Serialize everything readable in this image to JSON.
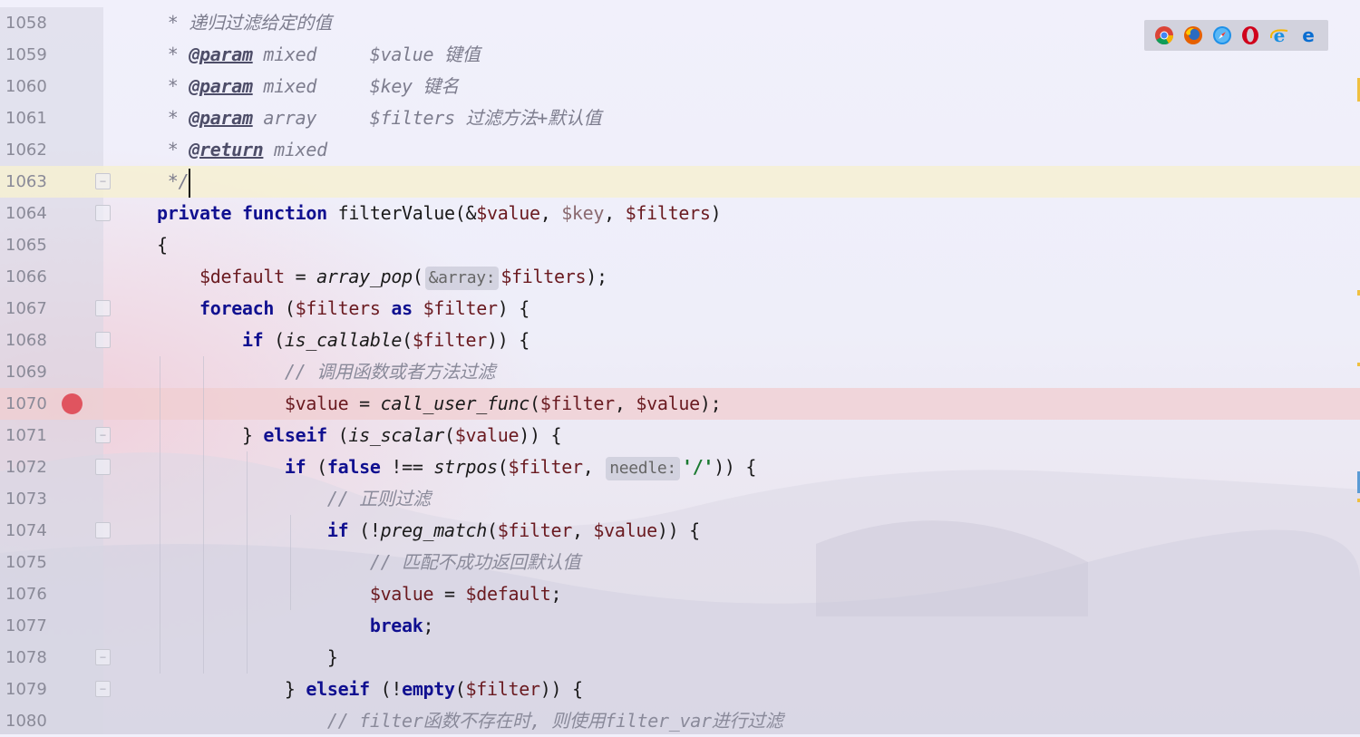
{
  "colors": {
    "keyword": "#101090",
    "variable": "#6a1a20",
    "comment": "#8a8a9a",
    "string": "#1a7a30",
    "breakpoint": "#e0545f",
    "caret_line": "#f6f0d2"
  },
  "browser_icons": [
    "chrome-icon",
    "firefox-icon",
    "safari-icon",
    "opera-icon",
    "ie-icon",
    "edge-icon"
  ],
  "lines": [
    {
      "num": "1058",
      "indent": "",
      "t": [
        [
          "doc",
          " * 递归过滤给定的值"
        ]
      ]
    },
    {
      "num": "1059",
      "indent": "",
      "t": [
        [
          "doc",
          " * "
        ],
        [
          "tag",
          "@param"
        ],
        [
          "doc",
          " mixed     $value 键值"
        ]
      ]
    },
    {
      "num": "1060",
      "indent": "",
      "t": [
        [
          "doc",
          " * "
        ],
        [
          "tag",
          "@param"
        ],
        [
          "doc",
          " mixed     $key 键名"
        ]
      ]
    },
    {
      "num": "1061",
      "indent": "",
      "t": [
        [
          "doc",
          " * "
        ],
        [
          "tag",
          "@param"
        ],
        [
          "doc",
          " array     $filters 过滤方法+默认值"
        ]
      ]
    },
    {
      "num": "1062",
      "indent": "",
      "t": [
        [
          "doc",
          " * "
        ],
        [
          "tag",
          "@return"
        ],
        [
          "doc",
          " mixed"
        ]
      ]
    },
    {
      "num": "1063",
      "indent": "",
      "t": [
        [
          "doc",
          " */"
        ]
      ]
    },
    {
      "num": "1064",
      "indent": "",
      "t": [
        [
          "kw",
          "private"
        ],
        [
          "p",
          " "
        ],
        [
          "kw",
          "function"
        ],
        [
          "p",
          " filterValue(&"
        ],
        [
          "var",
          "$value"
        ],
        [
          "p",
          ", "
        ],
        [
          "dim",
          "$key"
        ],
        [
          "p",
          ", "
        ],
        [
          "var",
          "$filters"
        ],
        [
          "p",
          ")"
        ]
      ]
    },
    {
      "num": "1065",
      "indent": "",
      "t": [
        [
          "p",
          "{"
        ]
      ]
    },
    {
      "num": "1066",
      "indent": "    ",
      "t": [
        [
          "var",
          "$default"
        ],
        [
          "p",
          " = "
        ],
        [
          "fn",
          "array_pop"
        ],
        [
          "p",
          "("
        ],
        [
          "hint",
          "&array:"
        ],
        [
          "var",
          "$filters"
        ],
        [
          "p",
          ");"
        ]
      ]
    },
    {
      "num": "1067",
      "indent": "    ",
      "t": [
        [
          "kw",
          "foreach"
        ],
        [
          "p",
          " ("
        ],
        [
          "var",
          "$filters"
        ],
        [
          "p",
          " "
        ],
        [
          "kw",
          "as"
        ],
        [
          "p",
          " "
        ],
        [
          "var",
          "$filter"
        ],
        [
          "p",
          ") {"
        ]
      ]
    },
    {
      "num": "1068",
      "indent": "        ",
      "t": [
        [
          "kw",
          "if"
        ],
        [
          "p",
          " ("
        ],
        [
          "fn",
          "is_callable"
        ],
        [
          "p",
          "("
        ],
        [
          "var",
          "$filter"
        ],
        [
          "p",
          ")) {"
        ]
      ]
    },
    {
      "num": "1069",
      "indent": "            ",
      "t": [
        [
          "cmt",
          "// 调用函数或者方法过滤"
        ]
      ]
    },
    {
      "num": "1070",
      "indent": "            ",
      "t": [
        [
          "var",
          "$value"
        ],
        [
          "p",
          " = "
        ],
        [
          "fn",
          "call_user_func"
        ],
        [
          "p",
          "("
        ],
        [
          "var",
          "$filter"
        ],
        [
          "p",
          ", "
        ],
        [
          "var",
          "$value"
        ],
        [
          "p",
          ");"
        ]
      ]
    },
    {
      "num": "1071",
      "indent": "        ",
      "t": [
        [
          "p",
          "} "
        ],
        [
          "kw",
          "elseif"
        ],
        [
          "p",
          " ("
        ],
        [
          "fn",
          "is_scalar"
        ],
        [
          "p",
          "("
        ],
        [
          "var",
          "$value"
        ],
        [
          "p",
          ")) {"
        ]
      ]
    },
    {
      "num": "1072",
      "indent": "            ",
      "t": [
        [
          "kw",
          "if"
        ],
        [
          "p",
          " ("
        ],
        [
          "kw",
          "false"
        ],
        [
          "p",
          " !== "
        ],
        [
          "fn",
          "strpos"
        ],
        [
          "p",
          "("
        ],
        [
          "var",
          "$filter"
        ],
        [
          "p",
          ", "
        ],
        [
          "hint",
          "needle:"
        ],
        [
          "str",
          "'/'"
        ],
        [
          "p",
          ")) {"
        ]
      ]
    },
    {
      "num": "1073",
      "indent": "                ",
      "t": [
        [
          "cmt",
          "// 正则过滤"
        ]
      ]
    },
    {
      "num": "1074",
      "indent": "                ",
      "t": [
        [
          "kw",
          "if"
        ],
        [
          "p",
          " (!"
        ],
        [
          "fn",
          "preg_match"
        ],
        [
          "p",
          "("
        ],
        [
          "var",
          "$filter"
        ],
        [
          "p",
          ", "
        ],
        [
          "var",
          "$value"
        ],
        [
          "p",
          ")) {"
        ]
      ]
    },
    {
      "num": "1075",
      "indent": "                    ",
      "t": [
        [
          "cmt",
          "// 匹配不成功返回默认值"
        ]
      ]
    },
    {
      "num": "1076",
      "indent": "                    ",
      "t": [
        [
          "var",
          "$value"
        ],
        [
          "p",
          " = "
        ],
        [
          "var",
          "$default"
        ],
        [
          "p",
          ";"
        ]
      ]
    },
    {
      "num": "1077",
      "indent": "                    ",
      "t": [
        [
          "kw",
          "break"
        ],
        [
          "p",
          ";"
        ]
      ]
    },
    {
      "num": "1078",
      "indent": "                ",
      "t": [
        [
          "p",
          "}"
        ]
      ]
    },
    {
      "num": "1079",
      "indent": "            ",
      "t": [
        [
          "p",
          "} "
        ],
        [
          "kw",
          "elseif"
        ],
        [
          "p",
          " (!"
        ],
        [
          "kw",
          "empty"
        ],
        [
          "p",
          "("
        ],
        [
          "var",
          "$filter"
        ],
        [
          "p",
          ")) {"
        ]
      ]
    },
    {
      "num": "1080",
      "indent": "                ",
      "t": [
        [
          "cmt",
          "// filter函数不存在时, 则使用filter_var进行过滤"
        ]
      ]
    }
  ]
}
